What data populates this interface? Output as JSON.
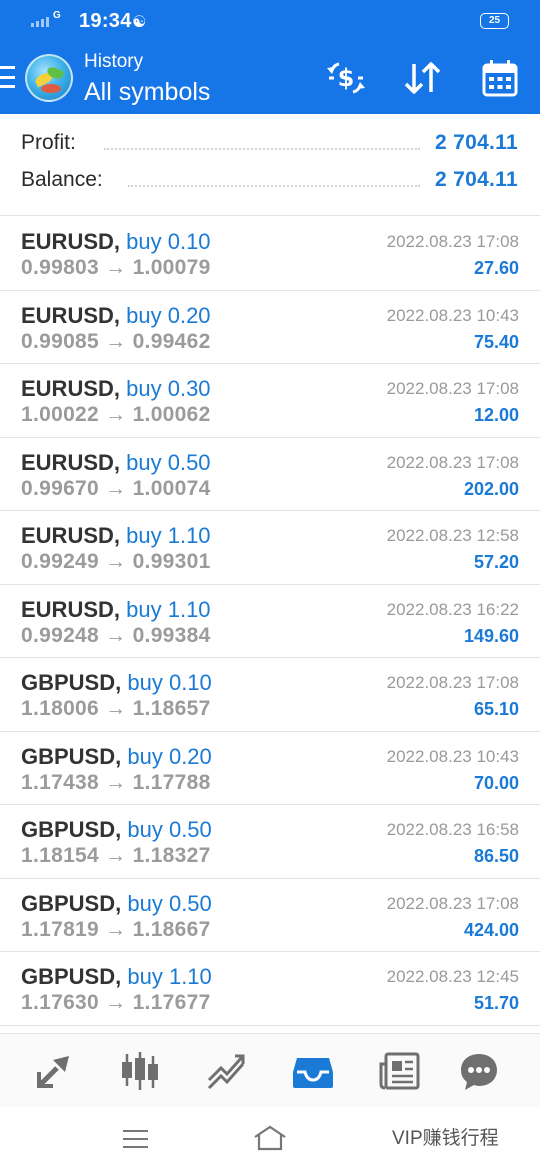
{
  "status_bar": {
    "network": "G",
    "time": "19:34",
    "battery": "25"
  },
  "header": {
    "subtitle": "History",
    "title": "All symbols",
    "icons": [
      "menu-icon",
      "app-logo",
      "currency-exchange-icon",
      "sort-icon",
      "calendar-icon"
    ]
  },
  "summary": {
    "profit_label": "Profit:",
    "profit_value": "2 704.11",
    "balance_label": "Balance:",
    "balance_value": "2 704.11"
  },
  "deals": [
    {
      "symbol": "EURUSD,",
      "side": "buy 0.10",
      "prices": "0.99803 → 1.00079",
      "time": "2022.08.23 17:08",
      "profit": "27.60"
    },
    {
      "symbol": "EURUSD,",
      "side": "buy 0.20",
      "prices": "0.99085 → 0.99462",
      "time": "2022.08.23 10:43",
      "profit": "75.40"
    },
    {
      "symbol": "EURUSD,",
      "side": "buy 0.30",
      "prices": "1.00022 → 1.00062",
      "time": "2022.08.23 17:08",
      "profit": "12.00"
    },
    {
      "symbol": "EURUSD,",
      "side": "buy 0.50",
      "prices": "0.99670 → 1.00074",
      "time": "2022.08.23 17:08",
      "profit": "202.00"
    },
    {
      "symbol": "EURUSD,",
      "side": "buy 1.10",
      "prices": "0.99249 → 0.99301",
      "time": "2022.08.23 12:58",
      "profit": "57.20"
    },
    {
      "symbol": "EURUSD,",
      "side": "buy 1.10",
      "prices": "0.99248 → 0.99384",
      "time": "2022.08.23 16:22",
      "profit": "149.60"
    },
    {
      "symbol": "GBPUSD,",
      "side": "buy 0.10",
      "prices": "1.18006 → 1.18657",
      "time": "2022.08.23 17:08",
      "profit": "65.10"
    },
    {
      "symbol": "GBPUSD,",
      "side": "buy 0.20",
      "prices": "1.17438 → 1.17788",
      "time": "2022.08.23 10:43",
      "profit": "70.00"
    },
    {
      "symbol": "GBPUSD,",
      "side": "buy 0.50",
      "prices": "1.18154 → 1.18327",
      "time": "2022.08.23 16:58",
      "profit": "86.50"
    },
    {
      "symbol": "GBPUSD,",
      "side": "buy 0.50",
      "prices": "1.17819 → 1.18667",
      "time": "2022.08.23 17:08",
      "profit": "424.00"
    },
    {
      "symbol": "GBPUSD,",
      "side": "buy 1.10",
      "prices": "1.17630 → 1.17677",
      "time": "2022.08.23 12:45",
      "profit": "51.70"
    }
  ],
  "bottom_nav": {
    "items": [
      "quotes-icon",
      "chart-icon",
      "trade-icon",
      "history-icon",
      "news-icon",
      "chat-icon"
    ],
    "active": "history-icon"
  },
  "watermark": "VIP赚钱行程",
  "colors": {
    "header_bg": "#1676e8",
    "accent": "#1a7ad6",
    "muted": "#9b9b9b"
  }
}
